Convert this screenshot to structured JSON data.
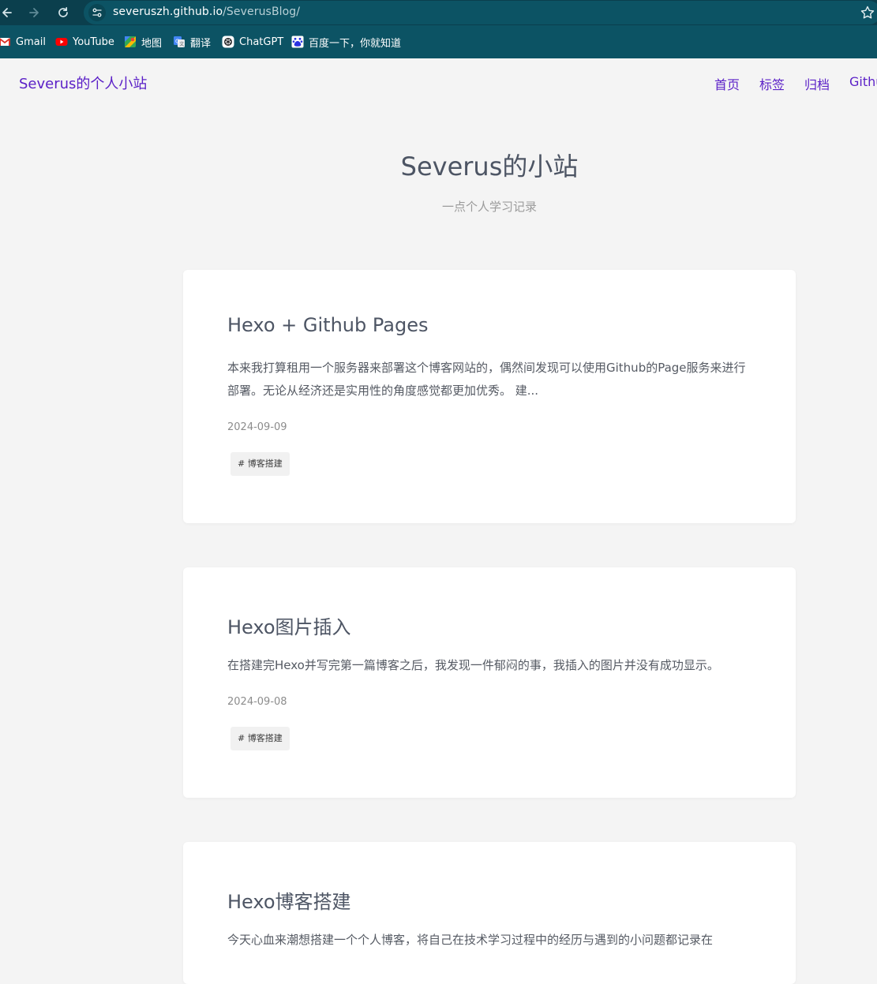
{
  "browser": {
    "url_host": "severuszh.github.io",
    "url_path": "/SeverusBlog/",
    "bookmarks": [
      {
        "label": "Gmail",
        "icon": "gmail-icon"
      },
      {
        "label": "YouTube",
        "icon": "youtube-icon"
      },
      {
        "label": "地图",
        "icon": "maps-icon"
      },
      {
        "label": "翻译",
        "icon": "translate-icon"
      },
      {
        "label": "ChatGPT",
        "icon": "chatgpt-icon"
      },
      {
        "label": "百度一下，你就知道",
        "icon": "baidu-icon"
      }
    ]
  },
  "site": {
    "brand": "Severus的个人小站",
    "nav": [
      "首页",
      "标签",
      "归档",
      "Github"
    ]
  },
  "hero": {
    "title": "Severus的小站",
    "subtitle": "一点个人学习记录"
  },
  "posts": [
    {
      "title": "Hexo + Github Pages",
      "excerpt": "本来我打算租用一个服务器来部署这个博客网站的，偶然间发现可以使用Github的Page服务来进行部署。无论从经济还是实用性的角度感觉都更加优秀。 建...",
      "date": "2024-09-09",
      "tag": "# 博客搭建"
    },
    {
      "title": "Hexo图片插入",
      "excerpt": "在搭建完Hexo并写完第一篇博客之后，我发现一件郁闷的事，我插入的图片并没有成功显示。",
      "date": "2024-09-08",
      "tag": "# 博客搭建"
    },
    {
      "title": "Hexo博客搭建",
      "excerpt": "今天心血来潮想搭建一个个人博客，将自己在技术学习过程中的经历与遇到的小问题都记录在"
    }
  ],
  "colors": {
    "accent": "#5a1fc7",
    "page_background": "#f4f4f4",
    "browser_toolbar": "#0b3f4d",
    "bookmarks_bar": "#0c5364"
  }
}
